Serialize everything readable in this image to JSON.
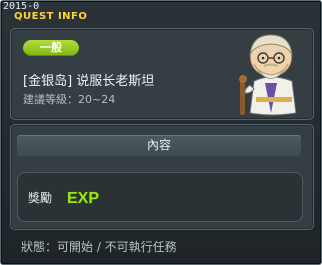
{
  "header": {
    "date": "2015-0",
    "title": "QUEST INFO"
  },
  "quest": {
    "category_badge": "一般",
    "name": "[金银岛] 说服长老斯坦",
    "level_requirement": "建議等級：20~24"
  },
  "content": {
    "header_label": "內容",
    "reward_label": "獎勵",
    "reward_icon": "EXP"
  },
  "status": {
    "text": "狀態：可開始 / 不可執行任務"
  },
  "colors": {
    "title": "#ffd33a",
    "badge": "#8fc322",
    "exp": "#9be31e"
  }
}
